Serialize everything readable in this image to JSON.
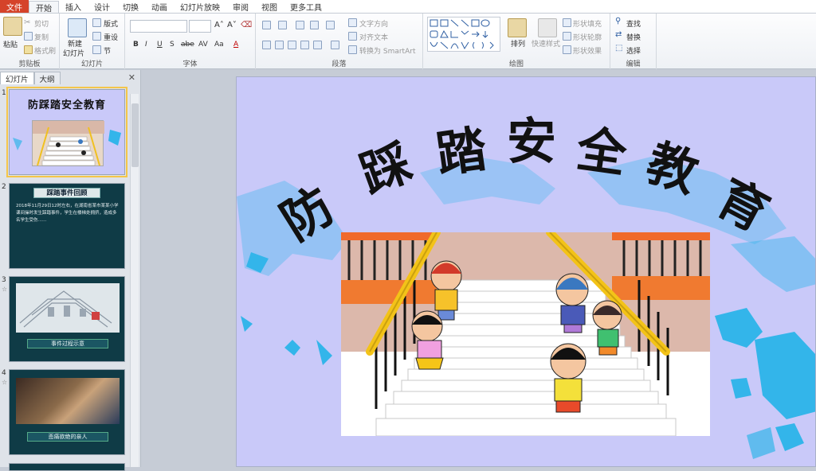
{
  "tabs": [
    "文件",
    "开始",
    "插入",
    "设计",
    "切换",
    "动画",
    "幻灯片放映",
    "审阅",
    "视图",
    "更多工具"
  ],
  "ribbon": {
    "clipboard": {
      "paste": "粘贴",
      "cut": "剪切",
      "copy": "复制",
      "format_painter": "格式刷",
      "label": "剪贴板"
    },
    "slides": {
      "new_slide_1": "新建",
      "new_slide_2": "幻灯片",
      "layout": "版式",
      "reset": "重设",
      "section": "节",
      "label": "幻灯片"
    },
    "font": {
      "label": "字体",
      "bold": "B",
      "italic": "I",
      "underline": "U",
      "shadow": "S",
      "strike": "abe",
      "spacing": "AV",
      "case": "Aa",
      "color": "A"
    },
    "paragraph": {
      "text_direction": "文字方向",
      "align_text": "对齐文本",
      "smartart": "转换为 SmartArt",
      "label": "段落"
    },
    "drawing": {
      "arrange": "排列",
      "quick_styles": "快速样式",
      "shape_fill": "形状填充",
      "shape_outline": "形状轮廓",
      "shape_effects": "形状效果",
      "label": "绘图"
    },
    "editing": {
      "find": "查找",
      "replace": "替换",
      "select": "选择",
      "label": "编辑"
    }
  },
  "panel": {
    "tab_slides": "幻灯片",
    "tab_outline": "大纲",
    "close": "✕"
  },
  "thumbnails": [
    {
      "num": "1",
      "title": "防踩踏安全教育"
    },
    {
      "num": "2",
      "title": "踩踏事件回顾",
      "body": "2018年11月29日12时左右，在湖南省某市某某小学课间操时发生踩踏事件，学生在楼梯处拥挤，造成多名学生受伤……"
    },
    {
      "num": "3",
      "caption": "事件过程示意"
    },
    {
      "num": "4",
      "caption": "悲痛欲绝的亲人"
    }
  ],
  "slide": {
    "title_chars": [
      "防",
      "踩",
      "踏",
      "安",
      "全",
      "教",
      "育"
    ]
  },
  "colors": {
    "slide_bg": "#c9c9f9",
    "map_blue": "#33b5ea",
    "file_tab": "#d5432a",
    "accent": "#f4c64a"
  }
}
